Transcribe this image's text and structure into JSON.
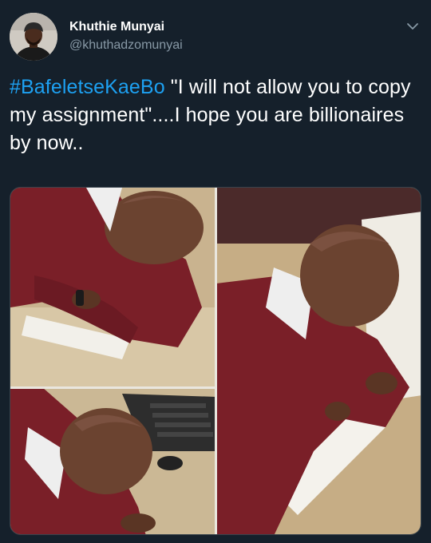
{
  "tweet": {
    "author": {
      "display_name": "Khuthie Munyai",
      "handle": "@khuthadzomunyai"
    },
    "text": {
      "hashtag": "#BafeletseKaeBo",
      "body": " \"I will not allow you to copy my assignment\"....I hope you are billionaires by now.."
    },
    "media": {
      "alt": "Collage of three photos of students in maroon school blazers leaning over a desk, covering their papers"
    }
  },
  "colors": {
    "background": "#15202b",
    "text": "#ffffff",
    "secondary_text": "#8899a6",
    "hashtag": "#1da1f2",
    "blazer": "#7a1f28"
  },
  "icons": {
    "menu": "chevron-down-icon"
  }
}
